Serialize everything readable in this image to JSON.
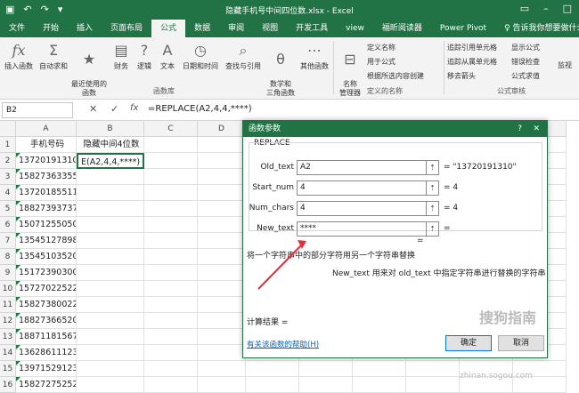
{
  "window": {
    "title": "隐藏手机号中间四位数.xlsx - Excel"
  },
  "tabs": [
    "文件",
    "开始",
    "插入",
    "页面布局",
    "公式",
    "数据",
    "审阅",
    "视图",
    "开发工具",
    "view",
    "福昕阅读器",
    "Power Pivot"
  ],
  "tell_me": "♀ 告诉我你想要做什么",
  "ribbon": {
    "insert_fn": "插入函数",
    "autosum": "自动求和",
    "recent": "最近使用的\n函数",
    "finance": "财务",
    "logic": "逻辑",
    "text": "文本",
    "datetime": "日期和时间",
    "lookup": "查找与引用",
    "math": "数学和\n三角函数",
    "other": "其他函数",
    "name_mgr": "名称\n管理器",
    "define": "定义名称",
    "use_in": "用于公式",
    "create_sel": "根据所选内容创建",
    "trace_prec": "追踪引用单元格",
    "trace_dep": "追踪从属单元格",
    "remove_arrows": "移去箭头",
    "show_formulas": "显示公式",
    "err_check": "错误检查",
    "eval": "公式求值",
    "watch": "监视",
    "group_lib": "函数库",
    "group_names": "定义的名称",
    "group_audit": "公式审核"
  },
  "formula_bar": {
    "name_box": "B2",
    "cancel": "✕",
    "enter": "✓",
    "fx": "fx",
    "formula": "=REPLACE(A2,4,4,****)"
  },
  "columns": [
    "A",
    "B",
    "C",
    "D",
    "E",
    "F",
    "G",
    "H",
    "I",
    "J"
  ],
  "rows": [
    {
      "num": "1",
      "a": "手机号码",
      "b": "隐藏中间4位数"
    },
    {
      "num": "2",
      "a": "13720191310",
      "b": "E(A2,4,4,****)"
    },
    {
      "num": "3",
      "a": "15827363355",
      "b": ""
    },
    {
      "num": "4",
      "a": "13720185511",
      "b": ""
    },
    {
      "num": "5",
      "a": "18827393737",
      "b": ""
    },
    {
      "num": "6",
      "a": "15071255050",
      "b": ""
    },
    {
      "num": "7",
      "a": "13545127898",
      "b": ""
    },
    {
      "num": "8",
      "a": "13545103520",
      "b": ""
    },
    {
      "num": "9",
      "a": "15172390300",
      "b": ""
    },
    {
      "num": "10",
      "a": "15727022522",
      "b": ""
    },
    {
      "num": "11",
      "a": "15827380022",
      "b": ""
    },
    {
      "num": "12",
      "a": "18827366520",
      "b": ""
    },
    {
      "num": "13",
      "a": "18871181567",
      "b": ""
    },
    {
      "num": "14",
      "a": "13628611123",
      "b": ""
    },
    {
      "num": "15",
      "a": "13971529123",
      "b": ""
    },
    {
      "num": "16",
      "a": "15827275252",
      "b": ""
    }
  ],
  "dialog": {
    "title": "函数参数",
    "q": "?",
    "close": "✕",
    "fn_name": "REPLACE",
    "args": [
      {
        "label": "Old_text",
        "value": "A2",
        "result": "= \"13720191310\""
      },
      {
        "label": "Start_num",
        "value": "4",
        "result": "= 4"
      },
      {
        "label": "Num_chars",
        "value": "4",
        "result": "= 4"
      },
      {
        "label": "New_text",
        "value": "****",
        "result": "="
      }
    ],
    "overall_eq": "=",
    "description": "将一个字符串中的部分字符用另一个字符串替换",
    "arg_desc": "New_text  用来对 old_text 中指定字符串进行替换的字符串",
    "calc_result": "计算结果 =",
    "help_link": "有关该函数的帮助(H)",
    "ok": "确定",
    "cancel": "取消"
  },
  "watermark": {
    "text": "搜狗指南",
    "url": "zhinan.sogou.com"
  },
  "colors": {
    "excel_green": "#217346",
    "highlight_red": "#e0303a"
  }
}
